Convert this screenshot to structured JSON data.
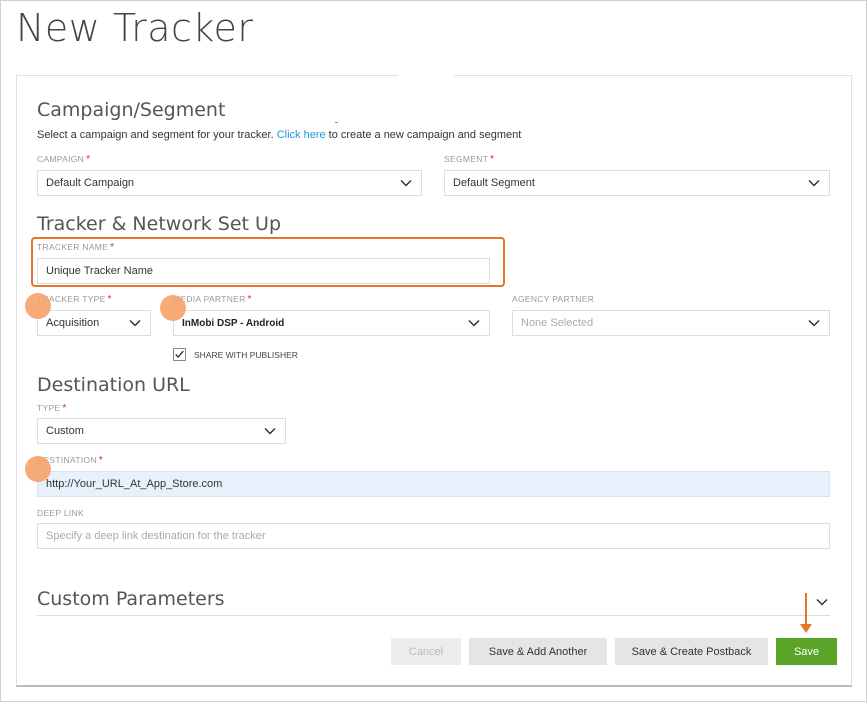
{
  "page": {
    "title": "New Tracker"
  },
  "campaign_section": {
    "title": "Campaign/Segment",
    "help_prefix": "Select a campaign and segment for your tracker.",
    "help_link": "Click here",
    "help_suffix": "to create a new campaign and segment",
    "campaign_label": "CAMPAIGN",
    "campaign_value": "Default Campaign",
    "segment_label": "SEGMENT",
    "segment_value": "Default Segment"
  },
  "tracker_section": {
    "title": "Tracker & Network Set Up",
    "tracker_name_label": "TRACKER NAME",
    "tracker_name_value": "Unique Tracker Name",
    "tracker_type_label": "TRACKER TYPE",
    "tracker_type_value": "Acquisition",
    "media_partner_label": "MEDIA PARTNER",
    "media_partner_value": "InMobi DSP - Android",
    "agency_partner_label": "AGENCY PARTNER",
    "agency_partner_placeholder": "None Selected",
    "share_label": "SHARE WITH PUBLISHER",
    "share_checked": true
  },
  "destination_section": {
    "title": "Destination URL",
    "type_label": "TYPE",
    "type_value": "Custom",
    "destination_label": "DESTINATION",
    "destination_value": "http://Your_URL_At_App_Store.com",
    "deep_link_label": "DEEP LINK",
    "deep_link_placeholder": "Specify a deep link destination for the tracker"
  },
  "custom_section": {
    "title": "Custom Parameters"
  },
  "buttons": {
    "cancel": "Cancel",
    "save_add": "Save & Add Another",
    "save_postback": "Save & Create Postback",
    "save": "Save"
  },
  "colors": {
    "accent_orange": "#e8742a",
    "highlight_dot": "#f5a26a",
    "link": "#1a9ad6",
    "save_green": "#5aa528",
    "required_red": "#d9242a",
    "destination_bg": "#e8f1fb"
  },
  "icons": [
    "chevron-down-icon",
    "checkmark-icon",
    "arrow-down-icon"
  ]
}
